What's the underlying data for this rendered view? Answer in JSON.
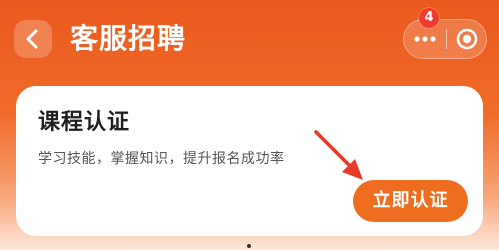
{
  "header": {
    "title": "客服招聘",
    "back_icon": "chevron-left-icon",
    "capsule": {
      "more_icon": "more-dots-icon",
      "close_icon": "target-circle-icon",
      "badge_count": "4"
    }
  },
  "card": {
    "title": "课程认证",
    "description": "学习技能，掌握知识，提升报名成功率",
    "button_label": "立即认证"
  },
  "colors": {
    "brand_orange": "#ef6d1f",
    "header_orange": "#ea5a1c",
    "badge_red": "#f23b2f",
    "annotation_red": "#e8392b"
  }
}
